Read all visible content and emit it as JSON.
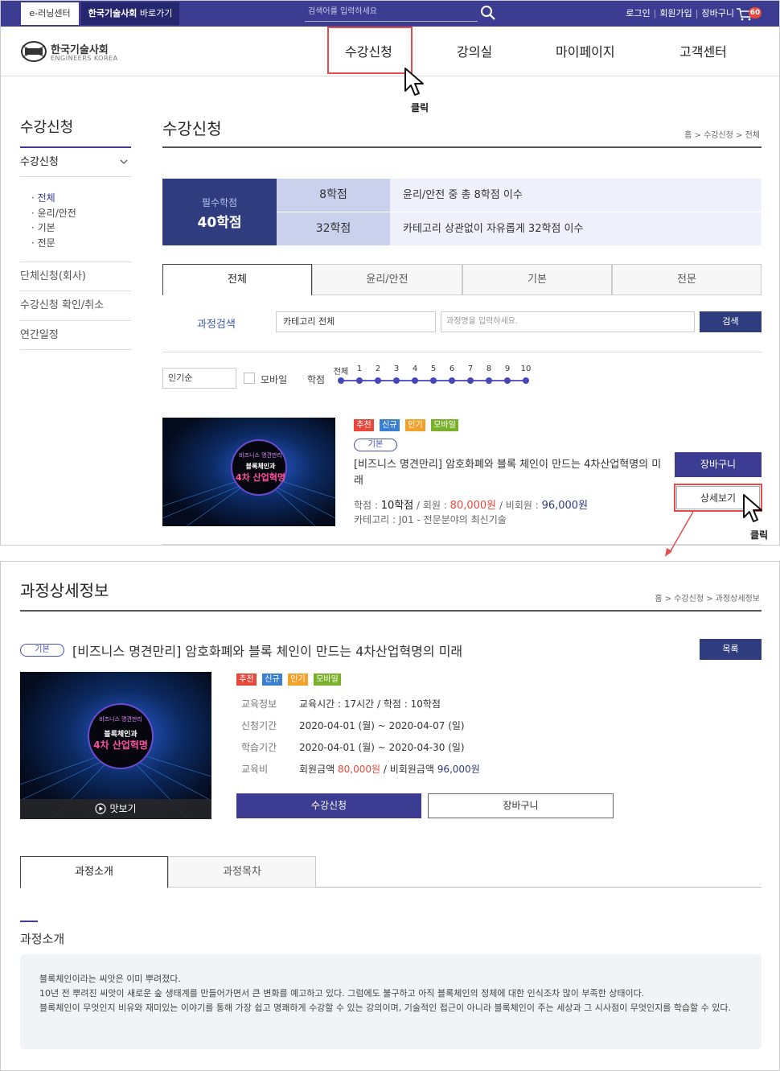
{
  "topbar": {
    "elearning_tab": "e-러닝센터",
    "kes_tab_bold": "한국기술사회",
    "kes_tab_rest": " 바로가기",
    "search_placeholder": "검색어를 입력하세요",
    "login": "로그인",
    "join": "회원가입",
    "cart": "장바구니",
    "cart_count": "60"
  },
  "logo": {
    "ko": "한국기술사회",
    "en": "ENGINEERS KOREA"
  },
  "gnb": [
    "수강신청",
    "강의실",
    "마이페이지",
    "고객센터"
  ],
  "annotations": {
    "click1": "클릭",
    "click2": "클릭"
  },
  "lnb": {
    "title": "수강신청",
    "head": "수강신청",
    "subs": [
      "· 전체",
      "· 윤리/안전",
      "· 기본",
      "· 전문"
    ],
    "items": [
      "단체신청(회사)",
      "수강신청 확인/취소",
      "연간일정"
    ]
  },
  "main": {
    "title": "수강신청",
    "breadcrumb": "홈 > 수강신청 > 전체",
    "credit": {
      "req_label": "필수학점",
      "req_value": "40학점",
      "rows": [
        {
          "credit": "8학점",
          "desc": "윤리/안전 중 총 8학점 이수"
        },
        {
          "credit": "32학점",
          "desc": "카테고리 상관없이 자유롭게 32학점 이수"
        }
      ]
    },
    "tabs": [
      "전체",
      "윤리/안전",
      "기본",
      "전문"
    ],
    "search": {
      "label": "과정검색",
      "category": "카테고리 전체",
      "placeholder": "과정명을 입력하세요.",
      "button": "검색"
    },
    "filter": {
      "sort": "인기순",
      "mobile": "모바일",
      "credit_label": "학점",
      "credit_steps": [
        "전체",
        "1",
        "2",
        "3",
        "4",
        "5",
        "6",
        "7",
        "8",
        "9",
        "10"
      ]
    },
    "course": {
      "badges": [
        "추천",
        "신규",
        "인기",
        "모바일"
      ],
      "category_pill": "기본",
      "title": "[비즈니스 명견만리] 암호화폐와 블록 체인이 만드는 4차산업혁명의 미래",
      "credit_label": "학점 : ",
      "credit_value": "10학점",
      "member_label": " / 회원 : ",
      "member_price": "80,000원",
      "nonmember_label": " / 비회원 : ",
      "nonmember_price": "96,000원",
      "category_line": "카테고리 : J01 - 전문분야의 최신기술",
      "cart_button": "장바구니",
      "detail_button": "상세보기",
      "thumb_small": "비즈니스 명견만리",
      "thumb_mid": "블록체인과",
      "thumb_big": "4차 산업혁명"
    }
  },
  "detail": {
    "title": "과정상세정보",
    "breadcrumb": "홈 > 수강신청 > 과정상세정보",
    "category_pill": "기본",
    "course_title": "[비즈니스 명견만리] 암호화폐와 블록 체인이 만드는 4차산업혁명의 미래",
    "list_button": "목록",
    "badges": [
      "추천",
      "신규",
      "인기",
      "모바일"
    ],
    "info": [
      {
        "label": "교육정보",
        "value": "교육시간 : 17시간 / 학점 : 10학점"
      },
      {
        "label": "신청기간",
        "value": "2020-04-01 (월) ~ 2020-04-07 (일)"
      },
      {
        "label": "학습기간",
        "value": "2020-04-01 (월) ~ 2020-04-30 (일)"
      }
    ],
    "fee": {
      "label": "교육비",
      "member_label": "회원금액 ",
      "member_price": "80,000원",
      "nonmember_label": " / 비회원금액 ",
      "nonmember_price": "96,000원"
    },
    "enroll_button": "수강신청",
    "cart_button": "장바구니",
    "preview": "맛보기",
    "tabs": [
      "과정소개",
      "과정목차"
    ],
    "section_title": "과정소개",
    "description": [
      "블록체인이라는 씨앗은 이미 뿌려졌다.",
      "10년 전 뿌려진 씨앗이 새로운 숲 생태계를 만들어가면서 큰 변화를 예고하고 있다. 그럼에도 불구하고 아직 블록체인의 정체에 대한 인식조차 많이 부족한 상태이다.",
      "블록체인이 무엇인지 비유와 재미있는 이야기를 통해 가장 쉽고 명쾌하게 수강할 수 있는 강의이며, 기술적인 접근이 아니라 블록체인이 주는 세상과 그 시사점이 무엇인지를 학습할 수 있다."
    ]
  },
  "colors": {
    "navy": "#3c3c93",
    "dark_navy": "#2f3c7e",
    "red": "#e8483b",
    "highlight": "#e74c4c"
  }
}
